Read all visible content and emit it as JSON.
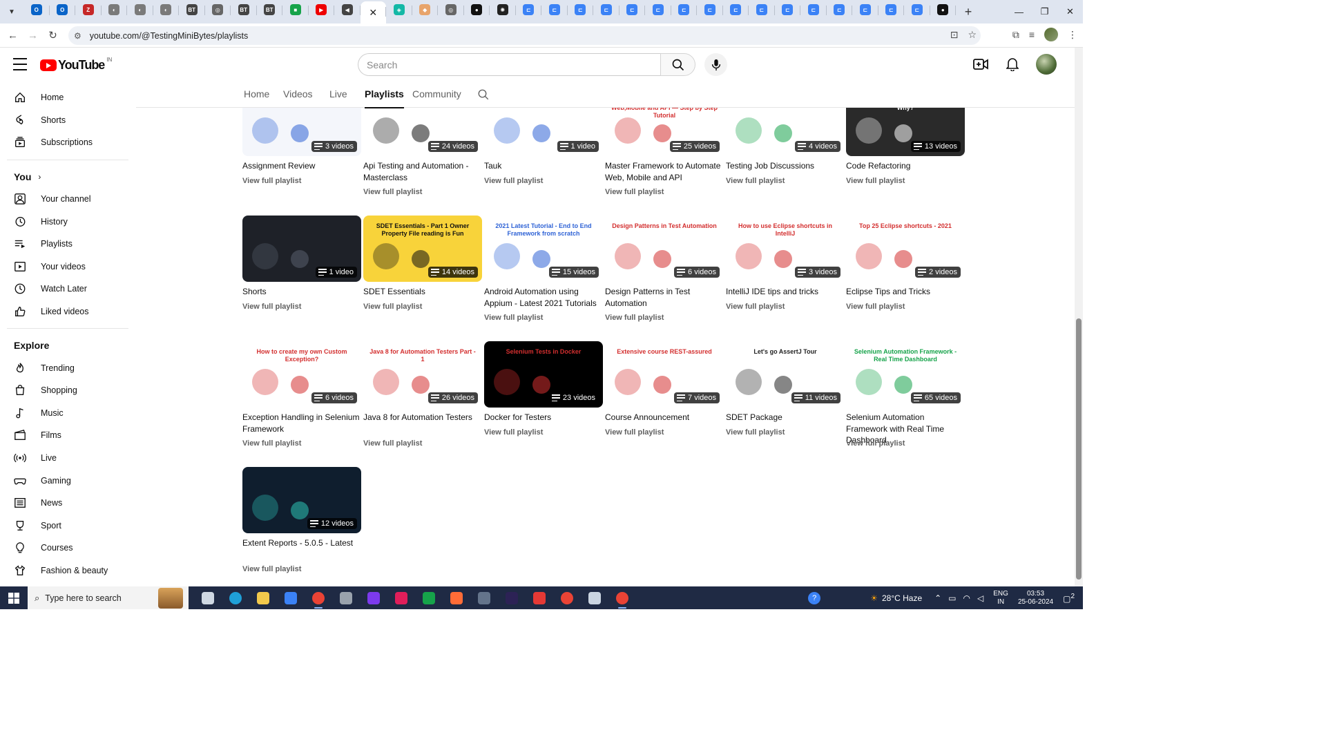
{
  "browser": {
    "tabs": [
      {
        "icon": "outlook-icon",
        "color": "#0a64c8",
        "glyph": "O"
      },
      {
        "icon": "outlook-icon",
        "color": "#0a64c8",
        "glyph": "O"
      },
      {
        "icon": "zoho-icon",
        "color": "#c62828",
        "glyph": "Z"
      },
      {
        "icon": "globe-icon",
        "color": "#7a7a7a",
        "glyph": "◐"
      },
      {
        "icon": "globe-icon",
        "color": "#7a7a7a",
        "glyph": "◐"
      },
      {
        "icon": "globe-icon",
        "color": "#7a7a7a",
        "glyph": "◐"
      },
      {
        "icon": "btg-icon",
        "color": "#444",
        "glyph": "BT"
      },
      {
        "icon": "chatgpt-icon",
        "color": "#666",
        "glyph": "◎"
      },
      {
        "icon": "btg-icon",
        "color": "#444",
        "glyph": "BT"
      },
      {
        "icon": "btg-icon",
        "color": "#444",
        "glyph": "BT"
      },
      {
        "icon": "chat-icon",
        "color": "#16a34a",
        "glyph": "■"
      },
      {
        "icon": "youtube-icon",
        "color": "#e00",
        "glyph": "▶"
      },
      {
        "icon": "audio-icon",
        "color": "#444",
        "glyph": "◀"
      },
      {
        "icon": "close-icon",
        "color": "#222",
        "glyph": "✕",
        "active": true
      },
      {
        "icon": "app-icon",
        "color": "#14b8a6",
        "glyph": "◈"
      },
      {
        "icon": "app-icon",
        "color": "#e8a46b",
        "glyph": "◆"
      },
      {
        "icon": "chatgpt-icon",
        "color": "#666",
        "glyph": "◎"
      },
      {
        "icon": "github-icon",
        "color": "#111",
        "glyph": "●"
      },
      {
        "icon": "openai-icon",
        "color": "#222",
        "glyph": "✺"
      },
      {
        "icon": "app-icon",
        "color": "#3b82f6",
        "glyph": "⊏"
      },
      {
        "icon": "app-icon",
        "color": "#3b82f6",
        "glyph": "⊏"
      },
      {
        "icon": "app-icon",
        "color": "#3b82f6",
        "glyph": "⊏"
      },
      {
        "icon": "app-icon",
        "color": "#3b82f6",
        "glyph": "⊏"
      },
      {
        "icon": "app-icon",
        "color": "#3b82f6",
        "glyph": "⊏"
      },
      {
        "icon": "app-icon",
        "color": "#3b82f6",
        "glyph": "⊏"
      },
      {
        "icon": "app-icon",
        "color": "#3b82f6",
        "glyph": "⊏"
      },
      {
        "icon": "app-icon",
        "color": "#3b82f6",
        "glyph": "⊏"
      },
      {
        "icon": "app-icon",
        "color": "#3b82f6",
        "glyph": "⊏"
      },
      {
        "icon": "app-icon",
        "color": "#3b82f6",
        "glyph": "⊏"
      },
      {
        "icon": "app-icon",
        "color": "#3b82f6",
        "glyph": "⊏"
      },
      {
        "icon": "app-icon",
        "color": "#3b82f6",
        "glyph": "⊏"
      },
      {
        "icon": "app-icon",
        "color": "#3b82f6",
        "glyph": "⊏"
      },
      {
        "icon": "app-icon",
        "color": "#3b82f6",
        "glyph": "⊏"
      },
      {
        "icon": "app-icon",
        "color": "#3b82f6",
        "glyph": "⊏"
      },
      {
        "icon": "app-icon",
        "color": "#3b82f6",
        "glyph": "⊏"
      },
      {
        "icon": "github-icon",
        "color": "#111",
        "glyph": "●"
      }
    ],
    "url": "youtube.com/@TestingMiniBytes/playlists"
  },
  "youtube": {
    "logo_text": "YouTube",
    "region": "IN",
    "search_placeholder": "Search"
  },
  "sidebar": {
    "main": [
      {
        "label": "Home",
        "icon": "home-icon"
      },
      {
        "label": "Shorts",
        "icon": "shorts-icon"
      },
      {
        "label": "Subscriptions",
        "icon": "subscriptions-icon"
      }
    ],
    "you_heading": "You",
    "you": [
      {
        "label": "Your channel",
        "icon": "channel-icon"
      },
      {
        "label": "History",
        "icon": "history-icon"
      },
      {
        "label": "Playlists",
        "icon": "playlists-icon"
      },
      {
        "label": "Your videos",
        "icon": "your-videos-icon"
      },
      {
        "label": "Watch Later",
        "icon": "watch-later-icon"
      },
      {
        "label": "Liked videos",
        "icon": "like-icon"
      }
    ],
    "explore_heading": "Explore",
    "explore": [
      {
        "label": "Trending",
        "icon": "trending-icon"
      },
      {
        "label": "Shopping",
        "icon": "shopping-icon"
      },
      {
        "label": "Music",
        "icon": "music-icon"
      },
      {
        "label": "Films",
        "icon": "films-icon"
      },
      {
        "label": "Live",
        "icon": "live-icon"
      },
      {
        "label": "Gaming",
        "icon": "gaming-icon"
      },
      {
        "label": "News",
        "icon": "news-icon"
      },
      {
        "label": "Sport",
        "icon": "sport-icon"
      },
      {
        "label": "Courses",
        "icon": "courses-icon"
      },
      {
        "label": "Fashion & beauty",
        "icon": "fashion-icon"
      }
    ]
  },
  "channel_tabs": [
    {
      "label": "Home"
    },
    {
      "label": "Videos"
    },
    {
      "label": "Live"
    },
    {
      "label": "Playlists",
      "active": true
    },
    {
      "label": "Community"
    }
  ],
  "view_full_playlist": "View full playlist",
  "playlists": [
    {
      "title": "Assignment Review",
      "count": "3 videos",
      "thumb_bg": "#f4f6fb",
      "accent": "#2f63d6",
      "thumb_text": ""
    },
    {
      "title": "Api Testing and Automation - Masterclass",
      "count": "24 videos",
      "thumb_bg": "#ffffff",
      "accent": "#111111",
      "thumb_text": ""
    },
    {
      "title": "Tauk",
      "count": "1 video",
      "thumb_bg": "#ffffff",
      "accent": "#2f63d6",
      "thumb_text": "Tauk  appium  espresso"
    },
    {
      "title": "Master Framework to Automate Web, Mobile and API",
      "count": "25 videos",
      "thumb_bg": "#ffffff",
      "accent": "#d32f2f",
      "thumb_text": "Single Framework to Automate Web,Mobile and API — Step by Step Tutorial"
    },
    {
      "title": "Testing Job Discussions",
      "count": "4 videos",
      "thumb_bg": "#ffffff",
      "accent": "#16a34a",
      "thumb_text": "How to get a job in SDET"
    },
    {
      "title": "Code Refactoring",
      "count": "13 videos",
      "thumb_bg": "#2a2a2a",
      "accent": "#ffffff",
      "thumb_text": "Code Refactoring PART - 1 What and Why?"
    },
    {
      "title": "Shorts",
      "count": "1 video",
      "thumb_bg": "#1e2128",
      "accent": "#59606e",
      "thumb_text": ""
    },
    {
      "title": "SDET Essentials",
      "count": "14 videos",
      "thumb_bg": "#f8d33a",
      "accent": "#111111",
      "thumb_text": "SDET Essentials - Part 1 Owner Property File reading is Fun"
    },
    {
      "title": "Android Automation using Appium - Latest 2021 Tutorials",
      "count": "15 videos",
      "thumb_bg": "#ffffff",
      "accent": "#2f63d6",
      "thumb_text": "2021 Latest Tutorial - End to End Framework from scratch"
    },
    {
      "title": "Design Patterns in Test Automation",
      "count": "6 videos",
      "thumb_bg": "#ffffff",
      "accent": "#d32f2f",
      "thumb_text": "Design Patterns in Test Automation"
    },
    {
      "title": "IntelliJ IDE tips and tricks",
      "count": "3 videos",
      "thumb_bg": "#ffffff",
      "accent": "#d32f2f",
      "thumb_text": "How to use Eclipse shortcuts in IntelliJ"
    },
    {
      "title": "Eclipse Tips and Tricks",
      "count": "2 videos",
      "thumb_bg": "#ffffff",
      "accent": "#d32f2f",
      "thumb_text": "Top 25 Eclipse shortcuts - 2021"
    },
    {
      "title": "Exception Handling in Selenium Framework",
      "count": "6 videos",
      "thumb_bg": "#ffffff",
      "accent": "#d32f2f",
      "thumb_text": "How to create my own Custom Exception?"
    },
    {
      "title": "Java 8 for Automation Testers",
      "count": "26 videos",
      "thumb_bg": "#ffffff",
      "accent": "#d32f2f",
      "thumb_text": "Java 8 for Automation Testers  Part - 1"
    },
    {
      "title": "Docker for Testers",
      "count": "23 videos",
      "thumb_bg": "#000000",
      "accent": "#d32f2f",
      "thumb_text": "Selenium Tests in Docker"
    },
    {
      "title": "Course Announcement",
      "count": "7 videos",
      "thumb_bg": "#ffffff",
      "accent": "#d32f2f",
      "thumb_text": "Extensive course  REST-assured"
    },
    {
      "title": "SDET Package",
      "count": "11 videos",
      "thumb_bg": "#ffffff",
      "accent": "#222222",
      "thumb_text": "Let's go AssertJ Tour"
    },
    {
      "title": "Selenium Automation Framework with Real Time Dashboard",
      "count": "65 videos",
      "thumb_bg": "#ffffff",
      "accent": "#16a34a",
      "thumb_text": "Selenium Automation Framework - Real Time Dashboard"
    },
    {
      "title": "Extent Reports - 5.0.5 - Latest",
      "count": "12 videos",
      "thumb_bg": "#0f1e2e",
      "accent": "#2ec4b6",
      "thumb_text": ""
    }
  ],
  "taskbar": {
    "search_placeholder": "Type here to search",
    "weather": "28°C  Haze",
    "lang_line1": "ENG",
    "lang_line2": "IN",
    "time": "03:53",
    "date": "25-06-2024",
    "notifications": "2"
  }
}
